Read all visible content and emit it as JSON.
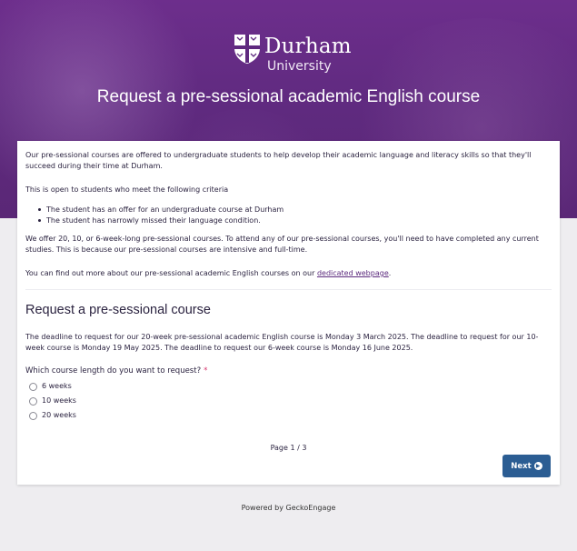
{
  "header": {
    "logo_brand": "Durham",
    "logo_sub": "University",
    "title": "Request a pre-sessional academic English course"
  },
  "intro": {
    "paragraph1": "Our pre-sessional courses are offered to undergraduate students to help develop their academic language and literacy skills so that they'll succeed during their time at Durham.",
    "criteria_heading": "This is open to students who meet the following criteria",
    "criteria": [
      "The student has an offer for an undergraduate course at Durham",
      "The student has narrowly missed their language condition."
    ],
    "paragraph2": "We offer 20, 10, or 6-week-long pre-sessional courses. To attend any of our pre-sessional courses, you'll need to have completed any current studies. This is because our pre-sessional courses are intensive and full-time.",
    "more_info_prefix": "You can find out more about our pre-sessional academic English courses on our ",
    "more_info_link": "dedicated webpage",
    "more_info_suffix": "."
  },
  "section": {
    "title": "Request a pre-sessional course",
    "deadline": "The deadline to request for our 20-week pre-sessional academic English course is Monday 3 March 2025. The deadline to request for our 10-week course is Monday 19 May 2025. The deadline to request our 6-week course is Monday 16 June 2025.",
    "question": "Which course length do you want to request?",
    "required_mark": "*",
    "options": [
      "6 weeks",
      "10 weeks",
      "20 weeks"
    ]
  },
  "pager": {
    "text": "Page 1 / 3"
  },
  "buttons": {
    "next_label": "Next"
  },
  "footer": {
    "powered_by": "Powered by GeckoEngage"
  },
  "colors": {
    "brand_purple": "#6d2e8c",
    "button_blue": "#2b5d93",
    "required_red": "#d6336c"
  },
  "icons": {
    "next": "arrow-circle-right-icon",
    "logo": "durham-shield-icon"
  }
}
